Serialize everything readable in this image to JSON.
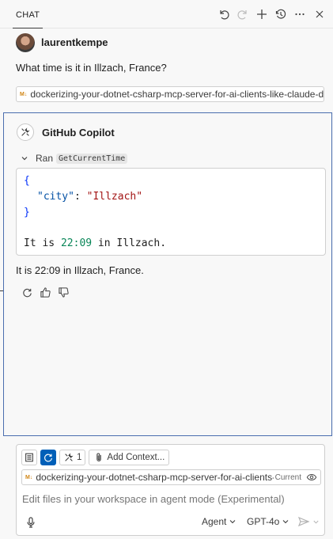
{
  "header": {
    "tab_label": "CHAT",
    "icons": [
      "undo-icon",
      "redo-icon",
      "plus-icon",
      "history-icon",
      "more-icon",
      "close-icon"
    ]
  },
  "user_turn": {
    "username": "laurentkempe",
    "message": "What time is it in Illzach, France?",
    "attachment": "dockerizing-your-dotnet-csharp-mcp-server-for-ai-clients-like-claude-desktop"
  },
  "response": {
    "agent_name": "GitHub Copilot",
    "ran_label": "Ran",
    "tool_name": "GetCurrentTime",
    "code": {
      "open_brace": "{",
      "key": "\"city\"",
      "colon": ": ",
      "value": "\"Illzach\"",
      "close_brace": "}",
      "result_prefix": "It is ",
      "result_time": "22:09",
      "result_suffix": " in Illzach."
    },
    "answer": "It is 22:09 in Illzach, France."
  },
  "input": {
    "tools_count": "1",
    "add_context_label": "Add Context...",
    "context_file": "dockerizing-your-dotnet-csharp-mcp-server-for-ai-clients-like-claude-desktop",
    "context_file_badge": "Current",
    "placeholder": "Edit files in your workspace in agent mode (Experimental)",
    "mode": "Agent",
    "model": "GPT-4o"
  },
  "colors": {
    "accent": "#005fb8",
    "response_border": "#4b6eaf",
    "markdown_icon": "#d18616"
  }
}
